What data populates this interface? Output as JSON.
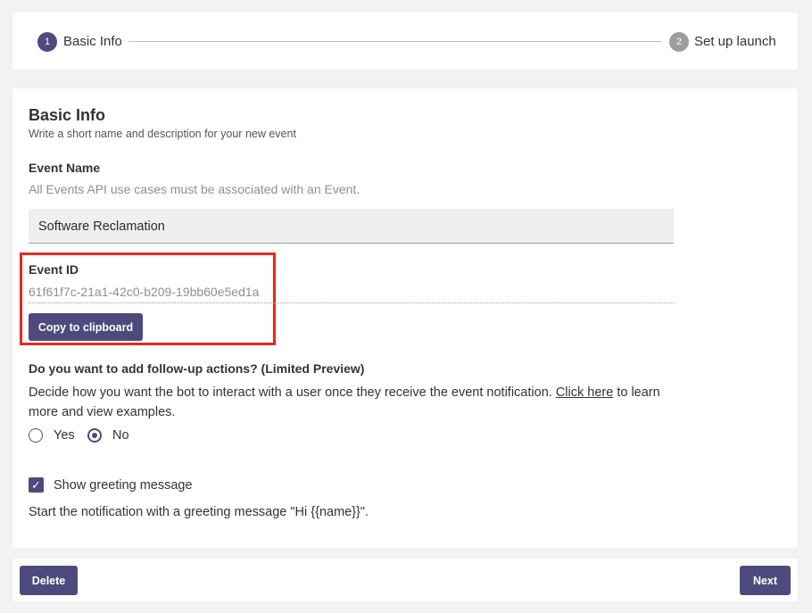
{
  "stepper": {
    "steps": [
      {
        "number": "1",
        "label": "Basic Info",
        "active": true
      },
      {
        "number": "2",
        "label": "Set up launch",
        "active": false
      }
    ]
  },
  "form": {
    "title": "Basic Info",
    "subtitle": "Write a short name and description for your new event",
    "event_name": {
      "label": "Event Name",
      "help": "All Events API use cases must be associated with an Event.",
      "value": "Software Reclamation"
    },
    "event_id": {
      "label": "Event ID",
      "value": "61f61f7c-21a1-42c0-b209-19bb60e5ed1a",
      "copy_label": "Copy to clipboard"
    },
    "followup": {
      "label": "Do you want to add follow-up actions? (Limited Preview)",
      "desc_before": "Decide how you want the bot to interact with a user once they receive the event notification.",
      "link_text": "Click here",
      "desc_after": "to learn",
      "desc_line2": "more and view examples.",
      "options": [
        "Yes",
        "No"
      ],
      "selected": "No"
    },
    "greeting": {
      "label": "Show greeting message",
      "checked": true,
      "desc": "Start the notification with a greeting message \"Hi {{name}}\"."
    }
  },
  "footer": {
    "delete_label": "Delete",
    "next_label": "Next"
  },
  "colors": {
    "accent": "#4f4a7d",
    "highlight": "#e8281e",
    "inactive_step": "#9e9e9e"
  }
}
